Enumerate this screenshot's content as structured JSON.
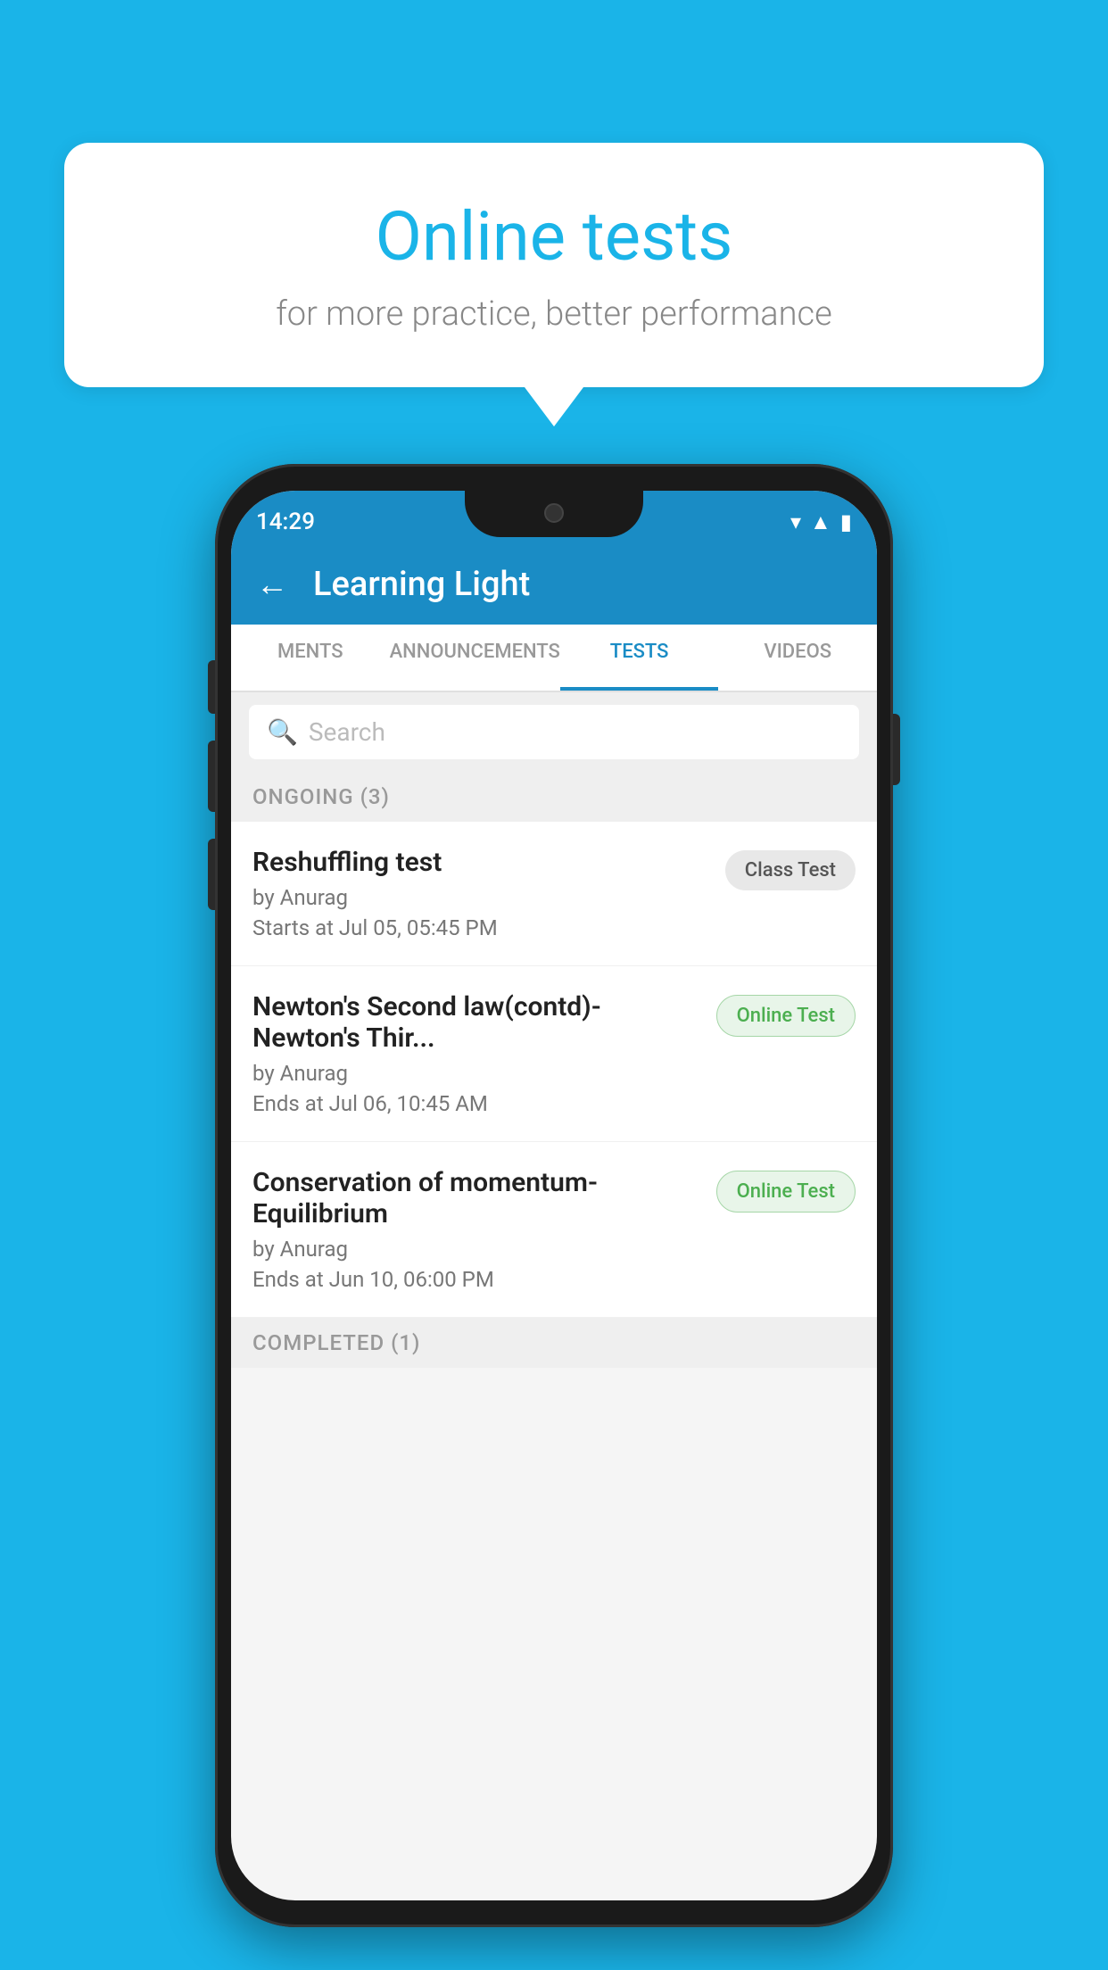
{
  "background_color": "#1ab4e8",
  "bubble": {
    "title": "Online tests",
    "subtitle": "for more practice, better performance"
  },
  "phone": {
    "status_bar": {
      "time": "14:29",
      "wifi": "▼",
      "signal": "▲",
      "battery": "▮"
    },
    "header": {
      "title": "Learning Light",
      "back_label": "←"
    },
    "tabs": [
      {
        "label": "MENTS",
        "active": false
      },
      {
        "label": "ANNOUNCEMENTS",
        "active": false
      },
      {
        "label": "TESTS",
        "active": true
      },
      {
        "label": "VIDEOS",
        "active": false
      }
    ],
    "search": {
      "placeholder": "Search"
    },
    "sections": [
      {
        "header": "ONGOING (3)",
        "items": [
          {
            "name": "Reshuffling test",
            "author": "by Anurag",
            "date": "Starts at  Jul 05, 05:45 PM",
            "badge": "Class Test",
            "badge_type": "class"
          },
          {
            "name": "Newton's Second law(contd)-Newton's Thir...",
            "author": "by Anurag",
            "date": "Ends at  Jul 06, 10:45 AM",
            "badge": "Online Test",
            "badge_type": "online"
          },
          {
            "name": "Conservation of momentum-Equilibrium",
            "author": "by Anurag",
            "date": "Ends at  Jun 10, 06:00 PM",
            "badge": "Online Test",
            "badge_type": "online"
          }
        ]
      },
      {
        "header": "COMPLETED (1)",
        "items": []
      }
    ]
  }
}
